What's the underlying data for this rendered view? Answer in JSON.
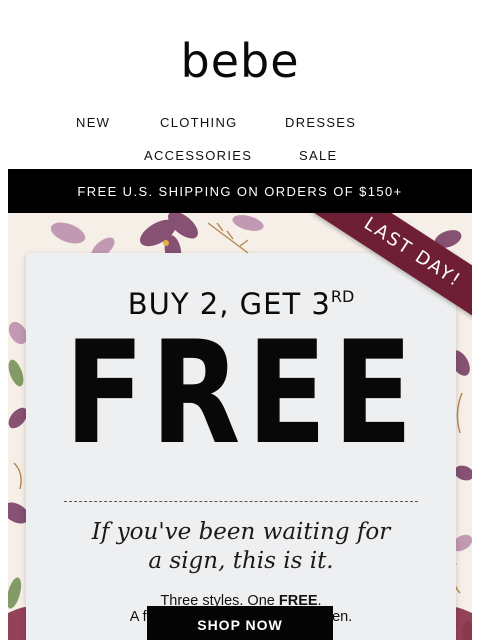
{
  "brand": {
    "logo_text": "bebe"
  },
  "nav": {
    "row1": [
      "NEW",
      "CLOTHING",
      "DRESSES"
    ],
    "row2": [
      "ACCESSORIES",
      "SALE"
    ]
  },
  "promo_bar": {
    "text": "FREE U.S. SHIPPING ON ORDERS OF $150+"
  },
  "hero": {
    "ribbon": "LAST DAY!",
    "headline_prefix": "BUY 2, GET 3",
    "headline_sup": "RD",
    "big_word": "FREE",
    "script_line_1": "If you've been waiting for",
    "script_line_2": "a sign, this is it.",
    "detail_prefix": "Three styles. One ",
    "detail_bold": "FREE",
    "detail_suffix": ".",
    "detail_line_2": "A few hours left to make it happen.",
    "cta": "SHOP NOW"
  },
  "colors": {
    "ribbon": "#6e1f35",
    "floral_purple": "#7a3f66",
    "floral_mauve": "#b98aa8",
    "floral_gold": "#b4874f",
    "floral_green": "#6e8c4f",
    "bar": "#000000"
  }
}
